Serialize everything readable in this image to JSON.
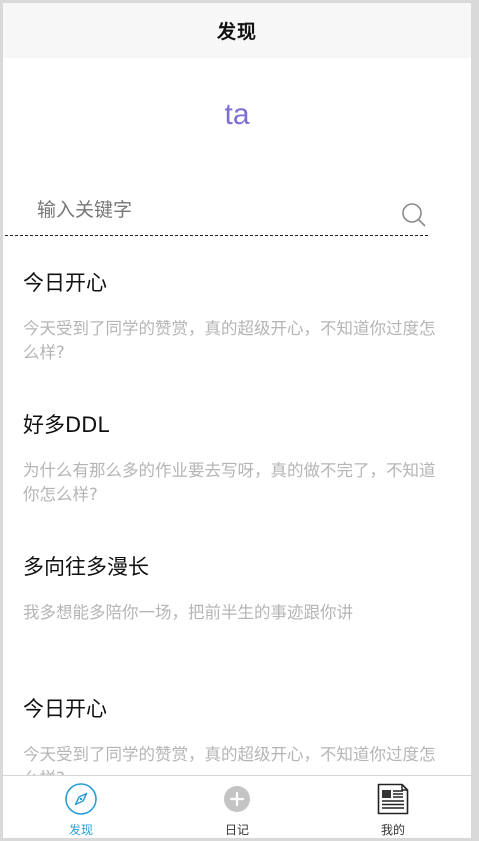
{
  "header": {
    "title": "发现"
  },
  "brand": {
    "logo_text": "ta",
    "logo_color": "#7b6fd6"
  },
  "search": {
    "placeholder": "输入关键字"
  },
  "posts": [
    {
      "title": "今日开心",
      "content": "今天受到了同学的赞赏，真的超级开心，不知道你过度怎么样?"
    },
    {
      "title": "好多DDL",
      "content": "为什么有那么多的作业要去写呀，真的做不完了，不知道你怎么样?"
    },
    {
      "title": "多向往多漫长",
      "content": "我多想能多陪你一场，把前半生的事迹跟你讲"
    },
    {
      "title": "今日开心",
      "content": "今天受到了同学的赞赏，真的超级开心，不知道你过度怎么样?"
    }
  ],
  "tabbar": {
    "active_color": "#2a9fd6",
    "items": [
      {
        "label": "发现",
        "icon": "compass-icon",
        "active": true
      },
      {
        "label": "日记",
        "icon": "plus-circle-icon",
        "active": false
      },
      {
        "label": "我的",
        "icon": "newspaper-icon",
        "active": false
      }
    ]
  }
}
